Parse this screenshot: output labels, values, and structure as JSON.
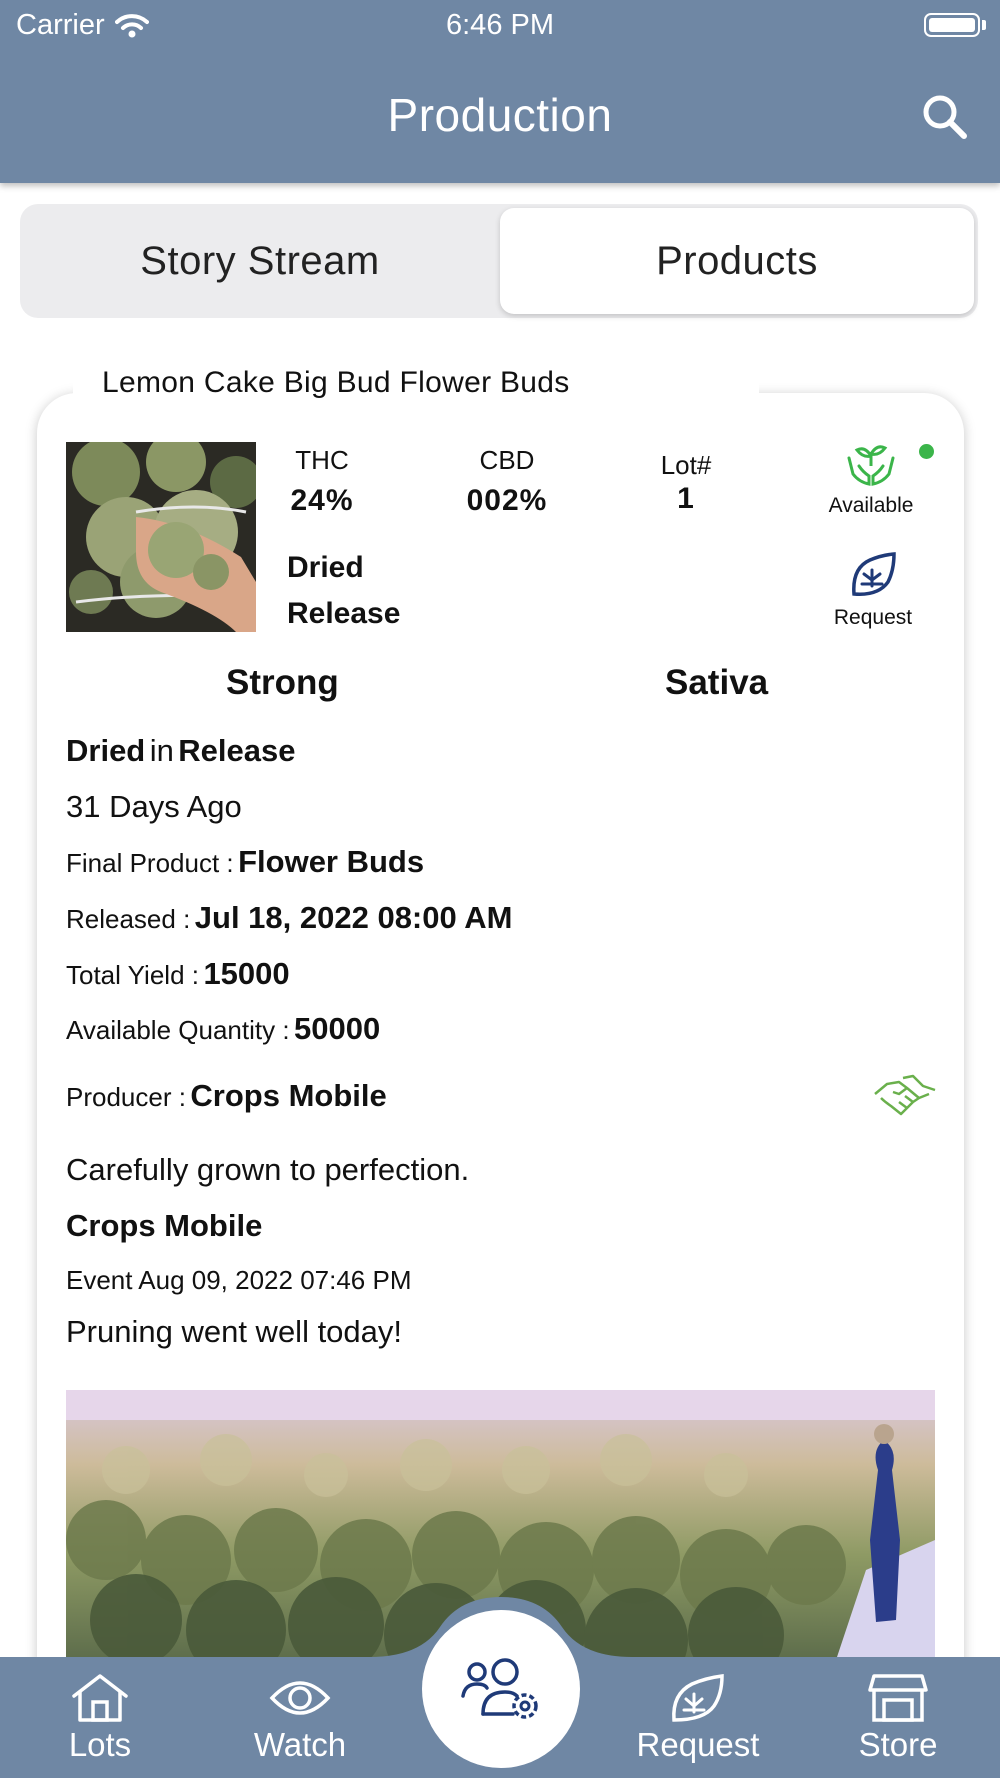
{
  "status_bar": {
    "carrier": "Carrier",
    "time": "6:46 PM"
  },
  "header": {
    "title": "Production"
  },
  "segmented": {
    "left": "Story Stream",
    "right": "Products",
    "selected": "Products"
  },
  "card": {
    "title": "Lemon Cake Big Bud Flower Buds",
    "thc_label": "THC",
    "thc_value": "24%",
    "cbd_label": "CBD",
    "cbd_value": "002%",
    "lot_label": "Lot#",
    "lot_value": "1",
    "stage_line1": "Dried",
    "stage_line2": "Release",
    "available_label": "Available",
    "request_label": "Request",
    "strength": "Strong",
    "strain": "Sativa",
    "state_bold1": "Dried",
    "state_in": "in",
    "state_bold2": "Release",
    "age": "31 Days Ago",
    "final_product_label": "Final Product :",
    "final_product_value": "Flower Buds",
    "released_label": "Released :",
    "released_value": "Jul 18, 2022 08:00 AM",
    "total_yield_label": "Total Yield :",
    "total_yield_value": "15000",
    "available_qty_label": "Available Quantity :",
    "available_qty_value": "50000",
    "producer_label": "Producer :",
    "producer_value": "Crops Mobile",
    "description": "Carefully grown to perfection.",
    "event_author": "Crops Mobile",
    "event_date": "Event Aug 09, 2022 07:46 PM",
    "event_text": "Pruning went well today!"
  },
  "tabbar": {
    "items": [
      {
        "label": "Lots",
        "icon": "house-icon"
      },
      {
        "label": "Watch",
        "icon": "eye-icon"
      },
      {
        "label": "",
        "icon": "users-gear-icon"
      },
      {
        "label": "Request",
        "icon": "cannabis-leaf-icon"
      },
      {
        "label": "Store",
        "icon": "store-icon"
      }
    ]
  },
  "colors": {
    "header": "#6f87a4",
    "accent_green": "#3bb54a",
    "icon_navy": "#1f3a78"
  }
}
